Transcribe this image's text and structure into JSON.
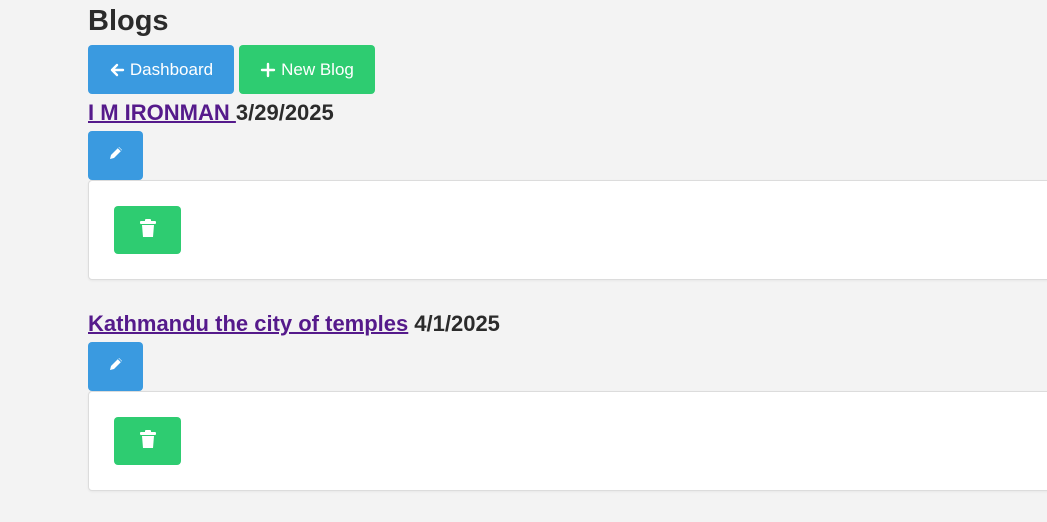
{
  "page": {
    "title": "Blogs"
  },
  "toolbar": {
    "dashboard_label": "Dashboard",
    "new_blog_label": "New Blog"
  },
  "blogs": [
    {
      "title": "I M IRONMAN ",
      "date": "3/29/2025"
    },
    {
      "title": "Kathmandu the city of temples",
      "date": "4/1/2025"
    }
  ],
  "colors": {
    "background": "#f3f3f3",
    "primary_blue": "#3a9ae0",
    "primary_green": "#2ecc71",
    "visited_link": "#551a8b",
    "text": "#2b2b2b"
  },
  "icons": {
    "dashboard": "arrow-left-icon",
    "new_blog": "plus-icon",
    "edit": "pencil-icon",
    "delete": "trash-icon"
  }
}
